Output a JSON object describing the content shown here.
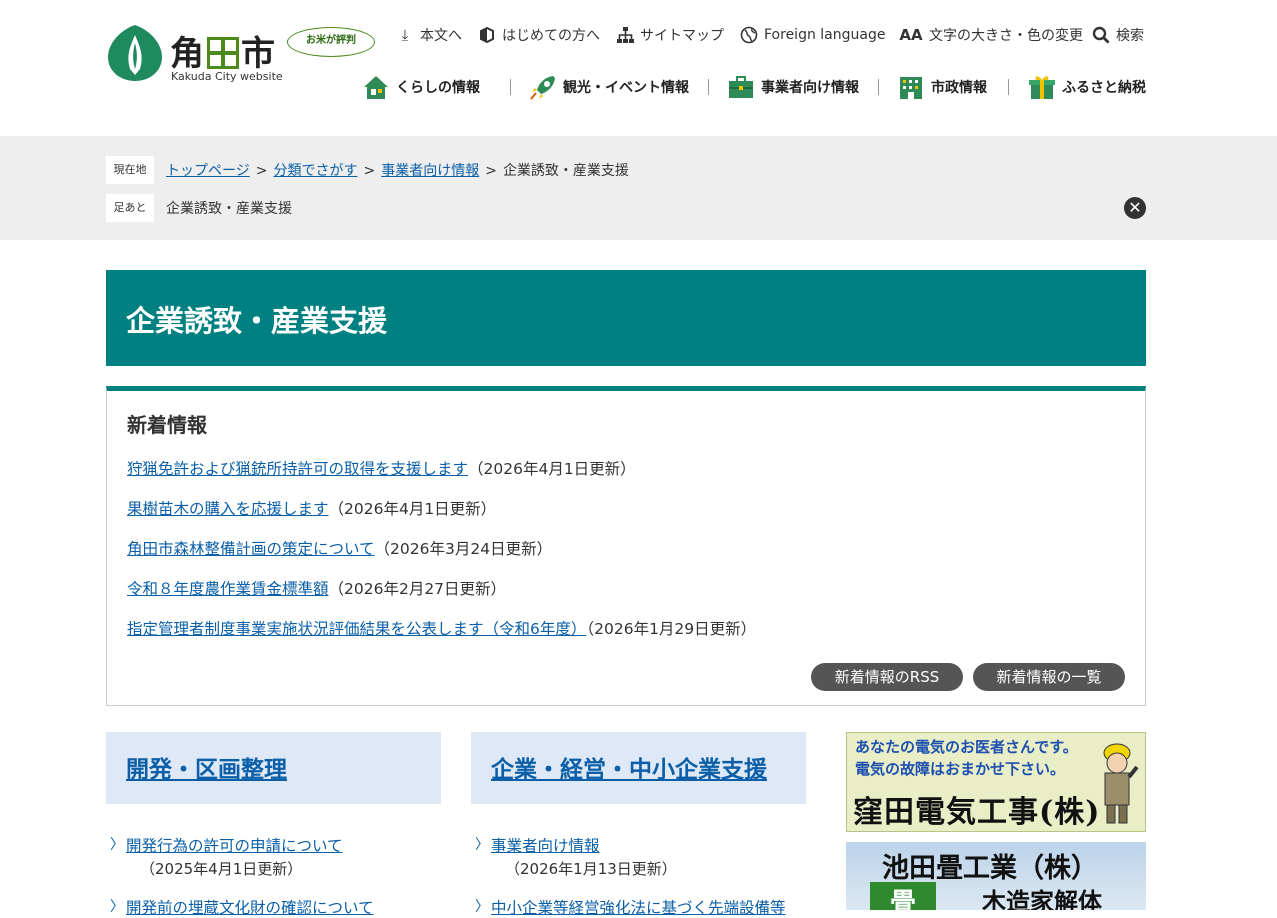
{
  "header": {
    "logo": {
      "name": "角田市",
      "sub": "Kakuda City website",
      "bubble": "お米が評判"
    },
    "util": [
      {
        "label": "本文へ",
        "icon": "download-icon"
      },
      {
        "label": "はじめての方へ",
        "icon": "beginner-mark-icon"
      },
      {
        "label": "サイトマップ",
        "icon": "sitemap-icon"
      },
      {
        "label": "Foreign language",
        "icon": "globe-icon"
      },
      {
        "label": "文字の大きさ・色の変更",
        "icon": "text-size-icon"
      },
      {
        "label": "検索",
        "icon": "search-icon"
      }
    ],
    "gnav": [
      {
        "label": "くらしの情報",
        "icon": "house-icon"
      },
      {
        "label": "観光・イベント情報",
        "icon": "rocket-icon"
      },
      {
        "label": "事業者向け情報",
        "icon": "briefcase-icon"
      },
      {
        "label": "市政情報",
        "icon": "building-icon"
      },
      {
        "label": "ふるさと納税",
        "icon": "gift-icon"
      }
    ]
  },
  "breadcrumb": {
    "current_tag": "現在地",
    "trail_tag": "足あと",
    "items": [
      "トップページ",
      "分類でさがす",
      "事業者向け情報",
      "企業誘致・産業支援"
    ],
    "footprint": "企業誘致・産業支援",
    "close_icon": "close-icon"
  },
  "page": {
    "title": "企業誘致・産業支援"
  },
  "news": {
    "heading": "新着情報",
    "items": [
      {
        "title": "狩猟免許および猟銃所持許可の取得を支援します",
        "date": "（2026年4月1日更新）"
      },
      {
        "title": "果樹苗木の購入を応援します",
        "date": "（2026年4月1日更新）"
      },
      {
        "title": "角田市森林整備計画の策定について",
        "date": "（2026年3月24日更新）"
      },
      {
        "title": "令和８年度農作業賃金標準額",
        "date": "（2026年2月27日更新）"
      },
      {
        "title": "指定管理者制度事業実施状況評価結果を公表します（令和6年度）",
        "date": "（2026年1月29日更新）"
      }
    ],
    "rss_button": "新着情報のRSS",
    "list_button": "新着情報の一覧"
  },
  "categories": [
    {
      "title": "開発・区画整理",
      "links": [
        {
          "title": "開発行為の許可の申請について",
          "date": "（2025年4月1日更新）"
        },
        {
          "title": "開発前の埋蔵文化財の確認について",
          "date": ""
        }
      ]
    },
    {
      "title": "企業・経営・中小企業支援",
      "links": [
        {
          "title": "事業者向け情報",
          "date": "（2026年1月13日更新）"
        },
        {
          "title": "中小企業等経営強化法に基づく先端設備等",
          "date": ""
        }
      ]
    }
  ],
  "ads": [
    {
      "line1": "あなたの電気のお医者さんです。",
      "line2": "電気の故障はおまかせ下さい。",
      "line3": "窪田電気工事(株)"
    },
    {
      "line1": "池田畳工業（株）",
      "mark": "畳",
      "line2": "木造家解体"
    }
  ],
  "colors": {
    "teal": "#008080",
    "link": "#0a5fa8",
    "category_bg": "#dfe8f7",
    "pill": "#555555",
    "logo_green": "#4c8a1e"
  }
}
